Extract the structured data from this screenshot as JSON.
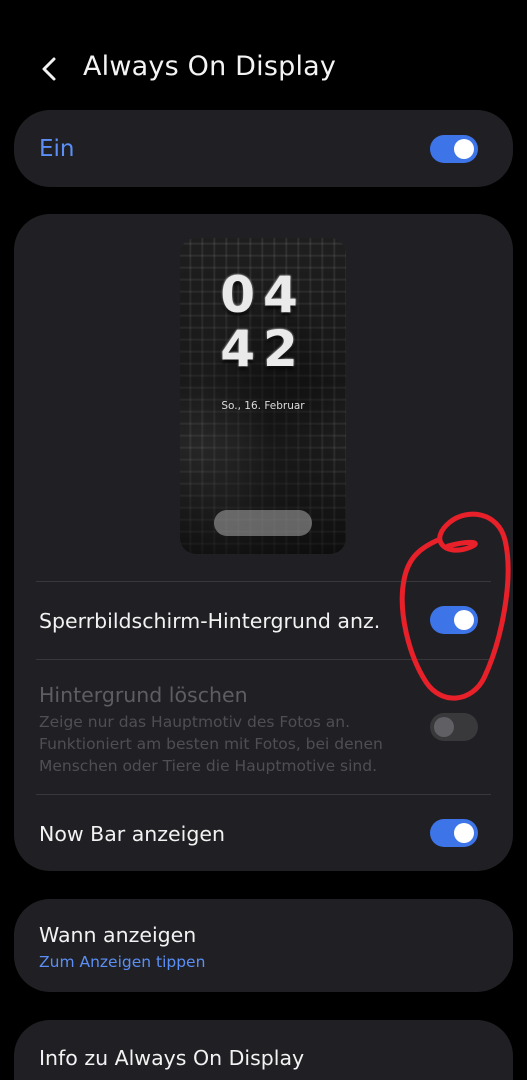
{
  "header": {
    "title": "Always On Display",
    "back_icon": "chevron-left-icon"
  },
  "master": {
    "label": "Ein",
    "enabled": true
  },
  "preview": {
    "hour": "04",
    "minute": "42",
    "date": "So., 16. Februar"
  },
  "settings": {
    "lockscreen_bg": {
      "label": "Sperrbildschirm-Hintergrund anz.",
      "enabled": true
    },
    "remove_bg": {
      "label": "Hintergrund löschen",
      "description": "Zeige nur das Hauptmotiv des Fotos an. Funktioniert am besten mit Fotos, bei denen Menschen oder Tiere die Hauptmotive sind.",
      "enabled": false
    },
    "now_bar": {
      "label": "Now Bar anzeigen",
      "enabled": true
    }
  },
  "when": {
    "title": "Wann anzeigen",
    "subtitle": "Zum Anzeigen tippen"
  },
  "info": {
    "title": "Info zu Always On Display"
  },
  "colors": {
    "accent": "#3d74e8",
    "accent_text": "#5b8ff5",
    "card": "#202024",
    "annotation": "#e8202a"
  }
}
